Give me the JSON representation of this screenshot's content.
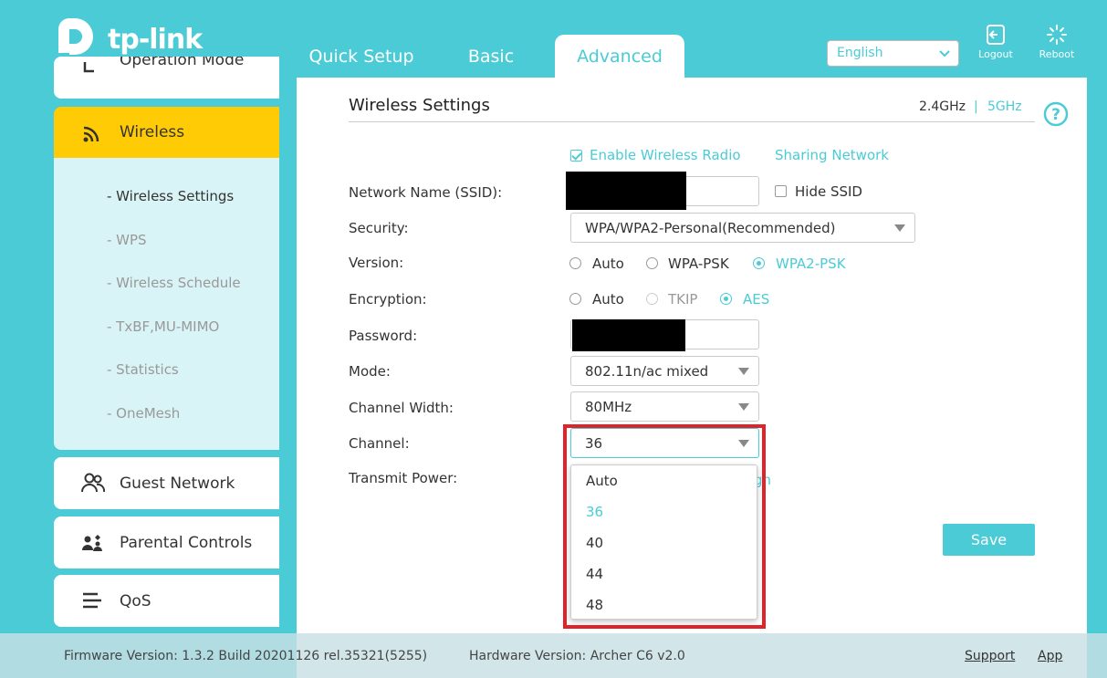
{
  "brand": {
    "name": "tp-link"
  },
  "tabs": [
    {
      "label": "Quick Setup"
    },
    {
      "label": "Basic"
    },
    {
      "label": "Advanced"
    }
  ],
  "header": {
    "language": "English",
    "logout": "Logout",
    "reboot": "Reboot"
  },
  "sidebar": {
    "top_item": "Operation Mode",
    "wireless": "Wireless",
    "sub_items": [
      {
        "label": "- Wireless Settings"
      },
      {
        "label": "- WPS"
      },
      {
        "label": "- Wireless Schedule"
      },
      {
        "label": "- TxBF,MU-MIMO"
      },
      {
        "label": "- Statistics"
      },
      {
        "label": "- OneMesh"
      }
    ],
    "guest": "Guest Network",
    "parental": "Parental Controls",
    "qos": "QoS"
  },
  "main": {
    "title": "Wireless Settings",
    "band_24": "2.4GHz",
    "band_sep": "|",
    "band_5": "5GHz",
    "enable_radio": "Enable Wireless Radio",
    "sharing_network": "Sharing Network",
    "ssid_label": "Network Name (SSID):",
    "hide_ssid": "Hide SSID",
    "security_label": "Security:",
    "security_value": "WPA/WPA2-Personal(Recommended)",
    "version_label": "Version:",
    "version_options": [
      "Auto",
      "WPA-PSK",
      "WPA2-PSK"
    ],
    "encryption_label": "Encryption:",
    "encryption_options": [
      "Auto",
      "TKIP",
      "AES"
    ],
    "password_label": "Password:",
    "mode_label": "Mode:",
    "mode_value": "802.11n/ac mixed",
    "width_label": "Channel Width:",
    "width_value": "80MHz",
    "channel_label": "Channel:",
    "channel_value": "36",
    "power_label": "Transmit Power:",
    "power_partial": "gh",
    "save": "Save"
  },
  "channel_dropdown": [
    "Auto",
    "36",
    "40",
    "44",
    "48"
  ],
  "footer": {
    "firmware": "Firmware Version: 1.3.2 Build 20201126 rel.35321(5255)",
    "hardware": "Hardware Version: Archer C6 v2.0",
    "support": "Support",
    "app": "App"
  },
  "colors": {
    "accent": "#4acbd6",
    "active_nav": "#ffcb05",
    "highlight": "#e0222a"
  }
}
